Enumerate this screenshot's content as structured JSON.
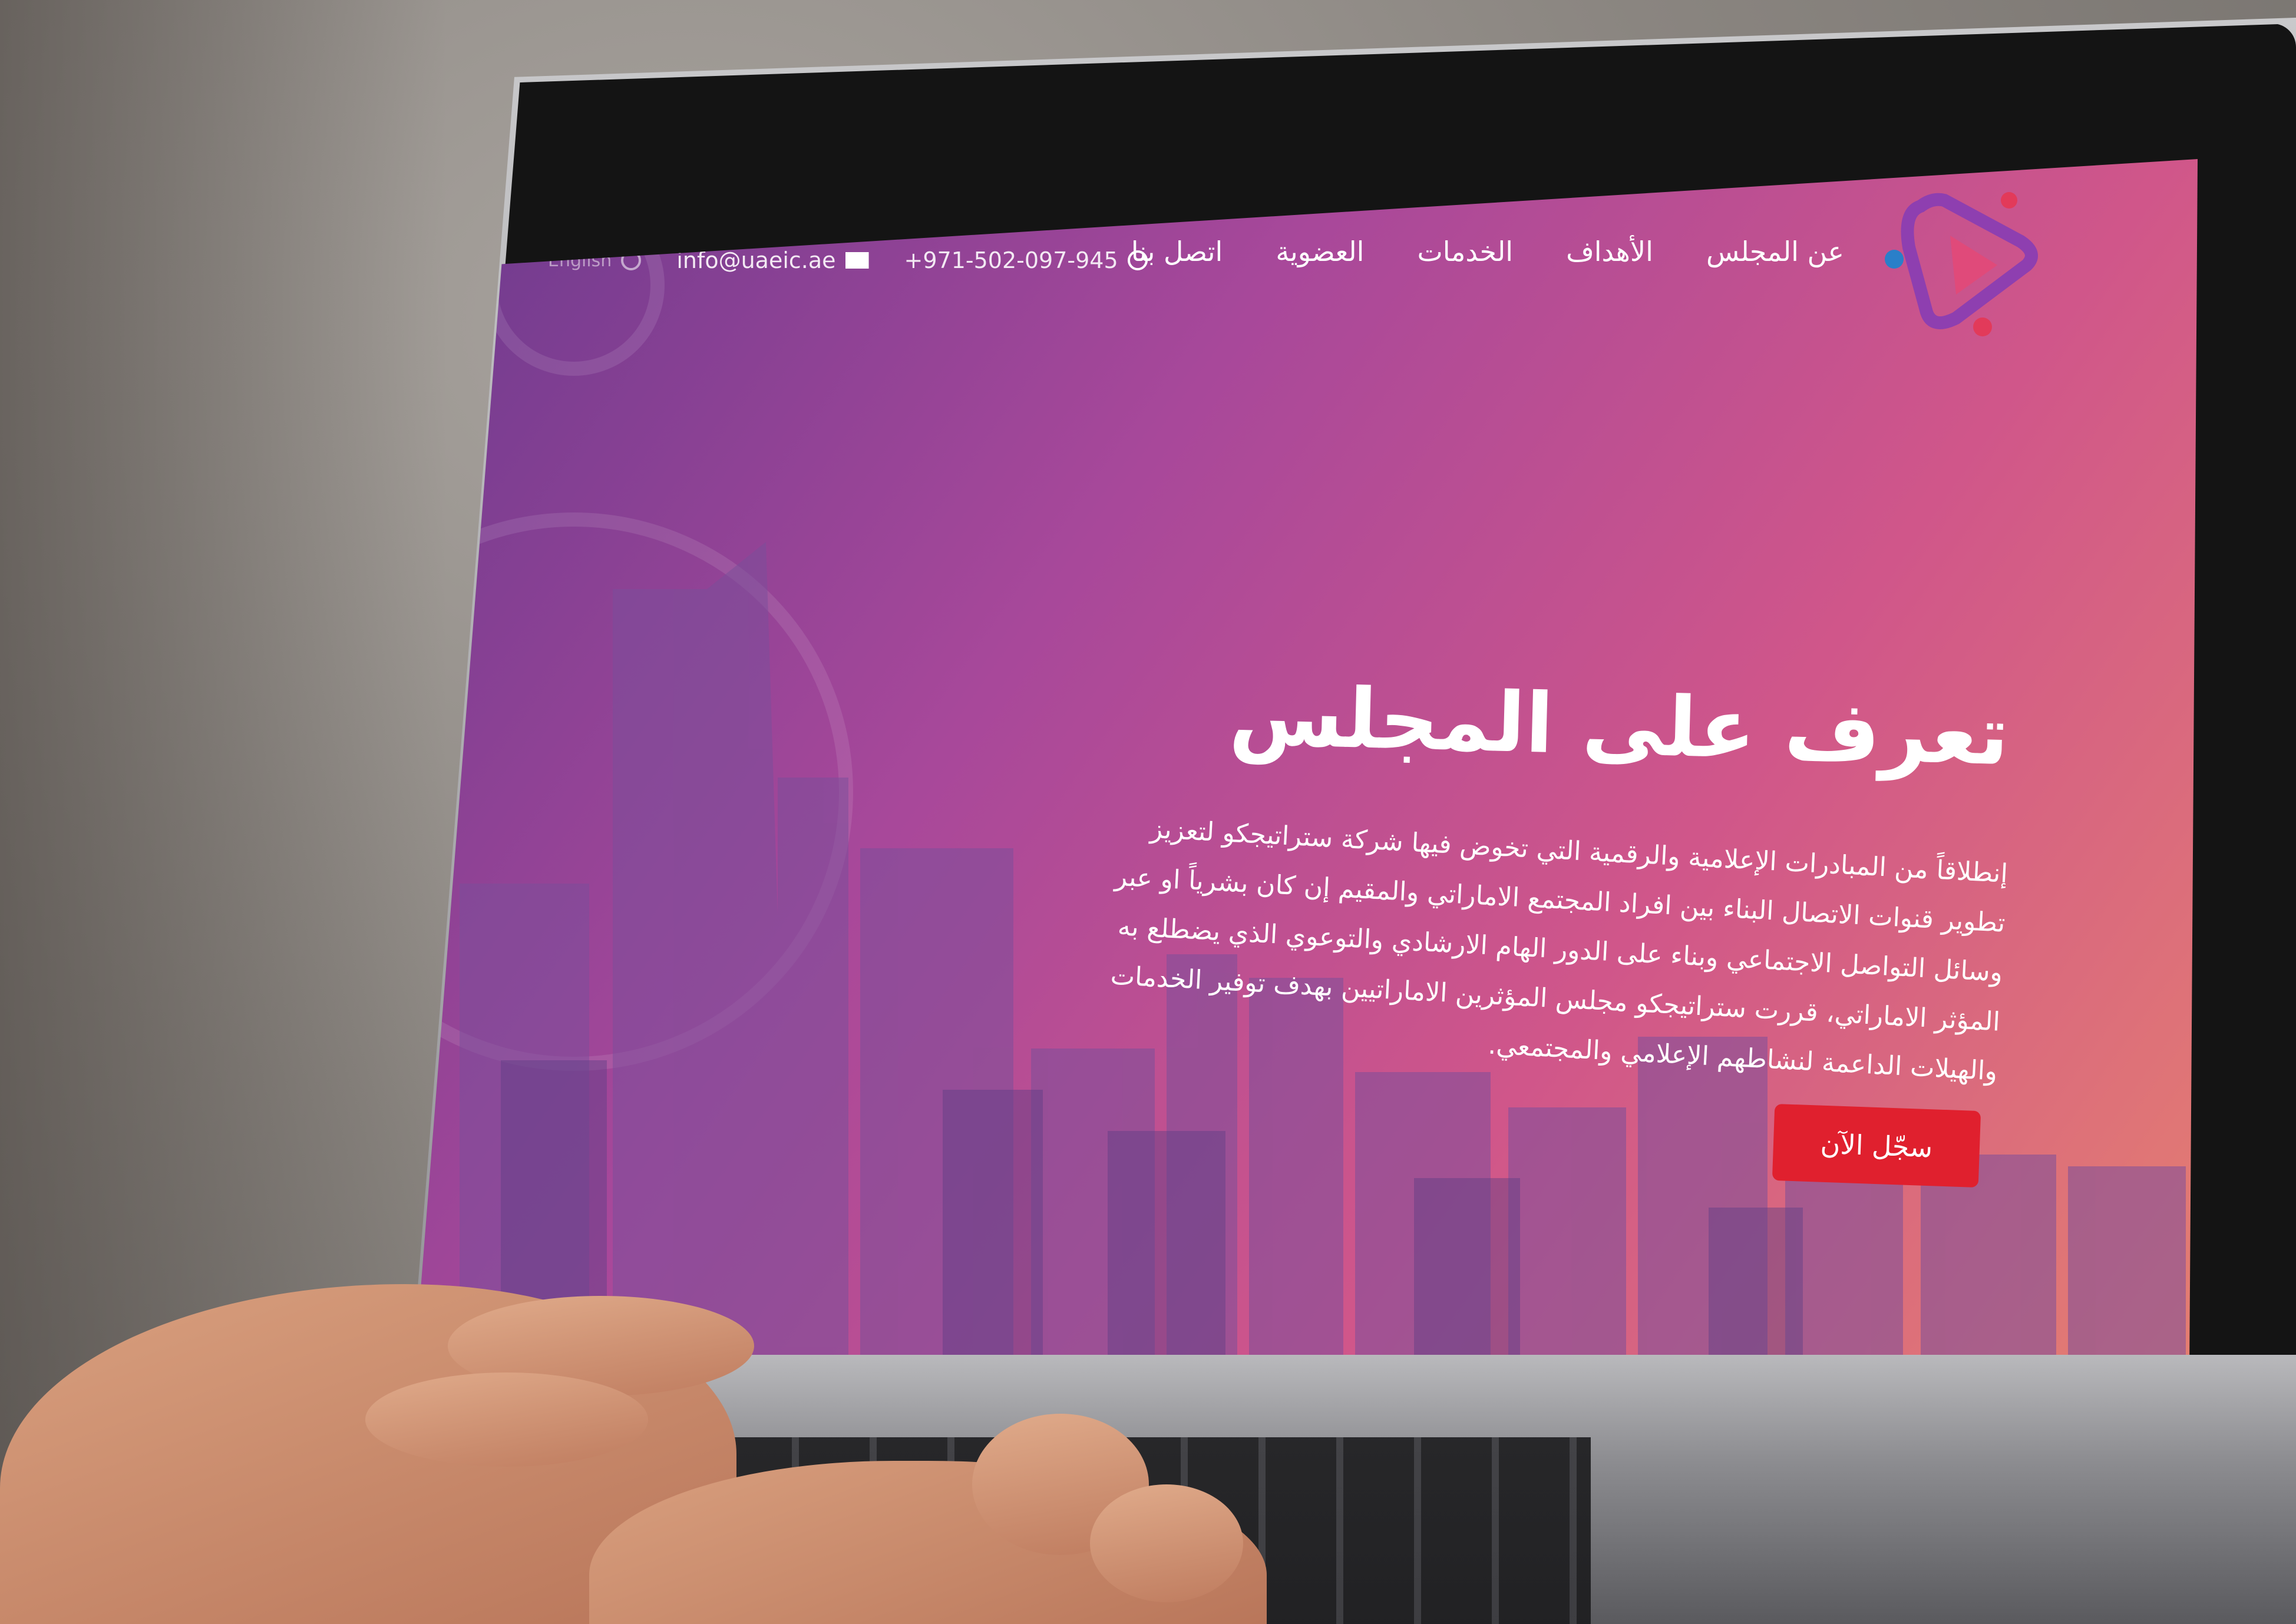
{
  "nav": {
    "items": [
      "عن المجلس",
      "الأهداف",
      "الخدمات",
      "العضوية",
      "اتصل بنا"
    ]
  },
  "contact": {
    "phone": "+971-502-097-945",
    "email": "info@uaeic.ae",
    "language": "English"
  },
  "hero": {
    "title": "تعرف على المجلس",
    "lines": [
      "إنطلاقاً من المبادرات الإعلامية والرقمية التي تخوض فيها شركة ستراتيجكو لتعزيز",
      "تطوير قنوات الاتصال البناء بين افراد المجتمع الاماراتي والمقيم إن كان بشرياً او عبر",
      "وسائل التواصل الاجتماعي وبناء على الدور الهام الارشادي والتوعوي الذي يضطلع به",
      "المؤثر الاماراتي، قررت ستراتيجكو مجلس المؤثرين الاماراتيين بهدف توفير الخدمات",
      "والهيلات الداعمة لنشاطهم الإعلامي والمجتمعي."
    ],
    "cta": "سجّل الآن"
  },
  "icons": {
    "phone": "whatsapp-icon",
    "email": "mail-icon",
    "language": "globe-icon",
    "logo": "play-logo"
  },
  "colors": {
    "cta": "#e0202e",
    "gradient_start": "#6b3a8e",
    "gradient_end": "#e6826e"
  }
}
